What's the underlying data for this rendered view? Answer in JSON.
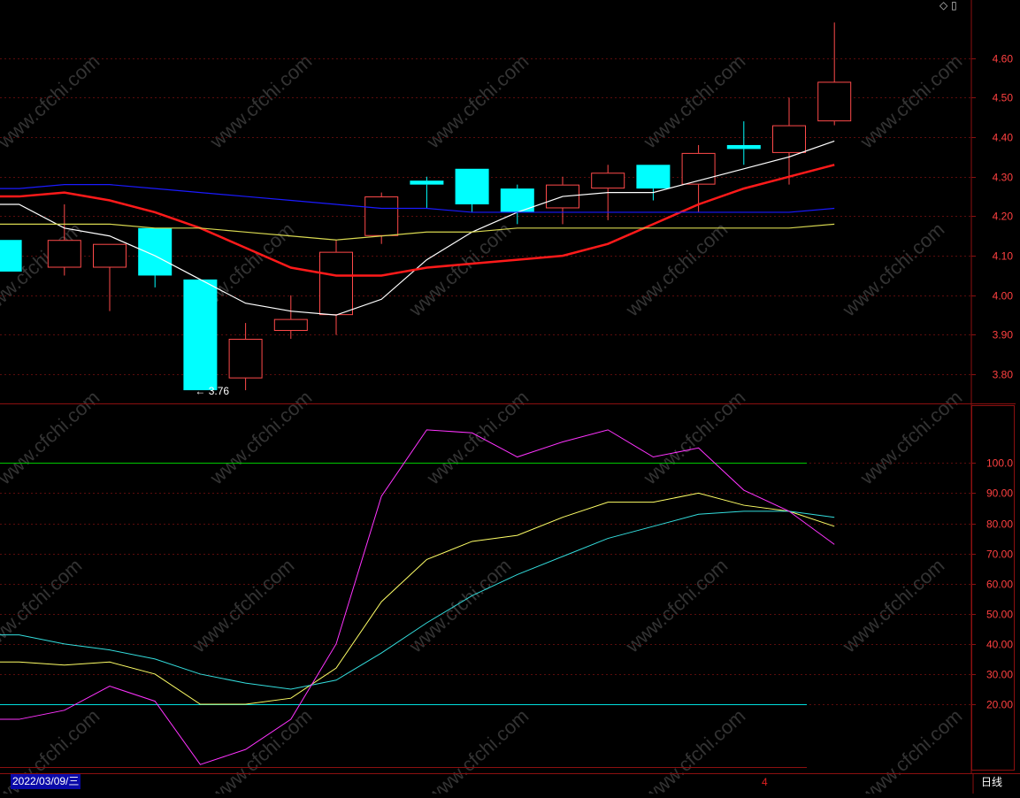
{
  "status_bar": {
    "date_label": "2022/03/09/三",
    "period_label": "日线",
    "month_marker": "4"
  },
  "toolbar_icons": [
    "diamond-icon",
    "square-icon"
  ],
  "colors": {
    "background": "#000000",
    "axis_red": "#8b1010",
    "grid_red": "#5a0c0c",
    "up_candle": "#ff4a4a",
    "down_candle": "#00ffff",
    "ma_white": "#ffffff",
    "ma_red": "#ff1a1a",
    "ma_blue": "#1a1aff",
    "ma_yellow": "#d8d850",
    "kdj_k": "#ffff66",
    "kdj_d": "#33dddd",
    "kdj_j": "#ff33ff",
    "level_green": "#00c800",
    "level_cyan": "#00dddd",
    "tick_text": "#ff4040",
    "watermark": "#333333"
  },
  "watermark_text": "www.cfchi.com",
  "chart_data": [
    {
      "type": "candlestick",
      "panel": "price",
      "ylim": [
        3.74,
        4.72
      ],
      "yticks": [
        3.8,
        3.9,
        4.0,
        4.1,
        4.2,
        4.3,
        4.4,
        4.5,
        4.6
      ],
      "ytick_labels": [
        "3.80",
        "3.90",
        "4.00",
        "4.10",
        "4.20",
        "4.30",
        "4.40",
        "4.50",
        "4.60"
      ],
      "low_annotation": "3.76",
      "candles": [
        {
          "open": 4.14,
          "close": 4.06,
          "high": 4.14,
          "low": 4.06
        },
        {
          "open": 4.07,
          "close": 4.14,
          "high": 4.23,
          "low": 4.05
        },
        {
          "open": 4.07,
          "close": 4.13,
          "high": 4.13,
          "low": 3.96
        },
        {
          "open": 4.17,
          "close": 4.05,
          "high": 4.17,
          "low": 4.02
        },
        {
          "open": 4.04,
          "close": 3.76,
          "high": 4.04,
          "low": 3.76
        },
        {
          "open": 3.79,
          "close": 3.89,
          "high": 3.93,
          "low": 3.76
        },
        {
          "open": 3.91,
          "close": 3.94,
          "high": 4.0,
          "low": 3.89
        },
        {
          "open": 3.95,
          "close": 4.11,
          "high": 4.14,
          "low": 3.9
        },
        {
          "open": 4.15,
          "close": 4.25,
          "high": 4.26,
          "low": 4.13
        },
        {
          "open": 4.29,
          "close": 4.28,
          "high": 4.3,
          "low": 4.22
        },
        {
          "open": 4.32,
          "close": 4.23,
          "high": 4.32,
          "low": 4.21
        },
        {
          "open": 4.27,
          "close": 4.21,
          "high": 4.28,
          "low": 4.18
        },
        {
          "open": 4.22,
          "close": 4.28,
          "high": 4.3,
          "low": 4.18
        },
        {
          "open": 4.27,
          "close": 4.31,
          "high": 4.33,
          "low": 4.19
        },
        {
          "open": 4.33,
          "close": 4.27,
          "high": 4.33,
          "low": 4.24
        },
        {
          "open": 4.28,
          "close": 4.36,
          "high": 4.38,
          "low": 4.21
        },
        {
          "open": 4.38,
          "close": 4.37,
          "high": 4.44,
          "low": 4.33
        },
        {
          "open": 4.36,
          "close": 4.43,
          "high": 4.5,
          "low": 4.28
        },
        {
          "open": 4.44,
          "close": 4.54,
          "high": 4.69,
          "low": 4.43
        }
      ],
      "series": [
        {
          "color_key": "ma_white",
          "values": [
            4.23,
            4.17,
            4.15,
            4.1,
            4.04,
            3.98,
            3.96,
            3.95,
            3.99,
            4.09,
            4.16,
            4.21,
            4.25,
            4.26,
            4.26,
            4.29,
            4.32,
            4.35,
            4.39
          ]
        },
        {
          "color_key": "ma_red",
          "values": [
            4.25,
            4.26,
            4.24,
            4.21,
            4.17,
            4.12,
            4.07,
            4.05,
            4.05,
            4.07,
            4.08,
            4.09,
            4.1,
            4.13,
            4.18,
            4.23,
            4.27,
            4.3,
            4.33
          ]
        },
        {
          "color_key": "ma_blue",
          "values": [
            4.27,
            4.28,
            4.28,
            4.27,
            4.26,
            4.25,
            4.24,
            4.23,
            4.22,
            4.22,
            4.21,
            4.21,
            4.21,
            4.21,
            4.21,
            4.21,
            4.21,
            4.21,
            4.22
          ]
        },
        {
          "color_key": "ma_yellow",
          "values": [
            4.18,
            4.18,
            4.18,
            4.17,
            4.17,
            4.16,
            4.15,
            4.14,
            4.15,
            4.16,
            4.16,
            4.17,
            4.17,
            4.17,
            4.17,
            4.17,
            4.17,
            4.17,
            4.18
          ]
        }
      ]
    },
    {
      "type": "line",
      "panel": "indicator",
      "ylim": [
        -2,
        118
      ],
      "yticks": [
        20,
        30,
        40,
        50,
        60,
        70,
        80,
        90,
        100
      ],
      "ytick_labels": [
        "20.00",
        "30.00",
        "40.00",
        "50.00",
        "60.00",
        "70.00",
        "80.00",
        "90.00",
        "100.0"
      ],
      "levels": [
        {
          "value": 100,
          "color_key": "level_green"
        },
        {
          "value": 20,
          "color_key": "level_cyan"
        }
      ],
      "series": [
        {
          "color_key": "kdj_k",
          "values": [
            34,
            33,
            34,
            30,
            20,
            20,
            22,
            32,
            54,
            68,
            74,
            76,
            82,
            87,
            87,
            90,
            86,
            84,
            79
          ]
        },
        {
          "color_key": "kdj_d",
          "values": [
            43,
            40,
            38,
            35,
            30,
            27,
            25,
            28,
            37,
            47,
            56,
            63,
            69,
            75,
            79,
            83,
            84,
            84,
            82
          ]
        },
        {
          "color_key": "kdj_j",
          "values": [
            15,
            18,
            26,
            21,
            0,
            5,
            15,
            40,
            89,
            111,
            110,
            102,
            107,
            111,
            102,
            105,
            91,
            84,
            73
          ]
        }
      ]
    }
  ]
}
